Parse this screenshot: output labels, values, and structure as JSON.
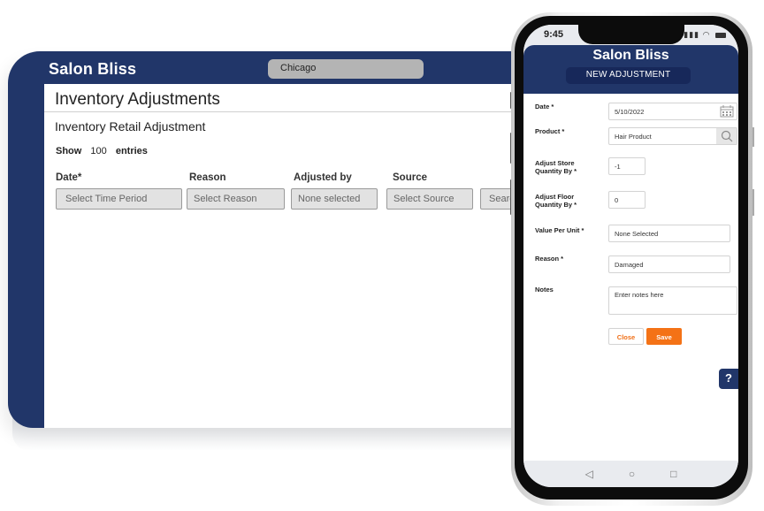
{
  "desktop": {
    "app_title": "Salon Bliss",
    "location": "Chicago",
    "page_title": "Inventory Adjustments",
    "subtitle": "Inventory Retail Adjustment",
    "entries": {
      "show_label": "Show",
      "count": "100",
      "entries_label": "entries"
    },
    "filters": [
      {
        "label": "Date*",
        "placeholder": "Select Time Period"
      },
      {
        "label": "Reason",
        "placeholder": "Select Reason"
      },
      {
        "label": "Adjusted by",
        "placeholder": "None selected"
      },
      {
        "label": "Source",
        "placeholder": "Select Source"
      },
      {
        "label": "",
        "placeholder": "Search"
      }
    ]
  },
  "phone": {
    "status": {
      "time": "9:45",
      "signal_icons": "signal-wifi-battery"
    },
    "app_title": "Salon Bliss",
    "screen_title": "NEW ADJUSTMENT",
    "form": {
      "date": {
        "label": "Date *",
        "value": "5/10/2022",
        "icon": "calendar-icon"
      },
      "product": {
        "label": "Product *",
        "value": "Hair Product",
        "icon": "search-icon"
      },
      "store_qty": {
        "label_line1": "Adjust Store",
        "label_line2": "Quantity By *",
        "value": "-1"
      },
      "floor_qty": {
        "label_line1": "Adjust Floor",
        "label_line2": "Quantity By *",
        "value": "0"
      },
      "value_per_unit": {
        "label": "Value Per Unit *",
        "value": "None Selected"
      },
      "reason": {
        "label": "Reason *",
        "value": "Damaged"
      },
      "notes": {
        "label": "Notes",
        "placeholder": "Enter notes here"
      }
    },
    "buttons": {
      "close": "Close",
      "save": "Save"
    },
    "help_label": "?",
    "nav": {
      "back": "◁",
      "home": "○",
      "recents": "□"
    }
  },
  "colors": {
    "brand_navy": "#213669",
    "accent_orange": "#f47216"
  }
}
